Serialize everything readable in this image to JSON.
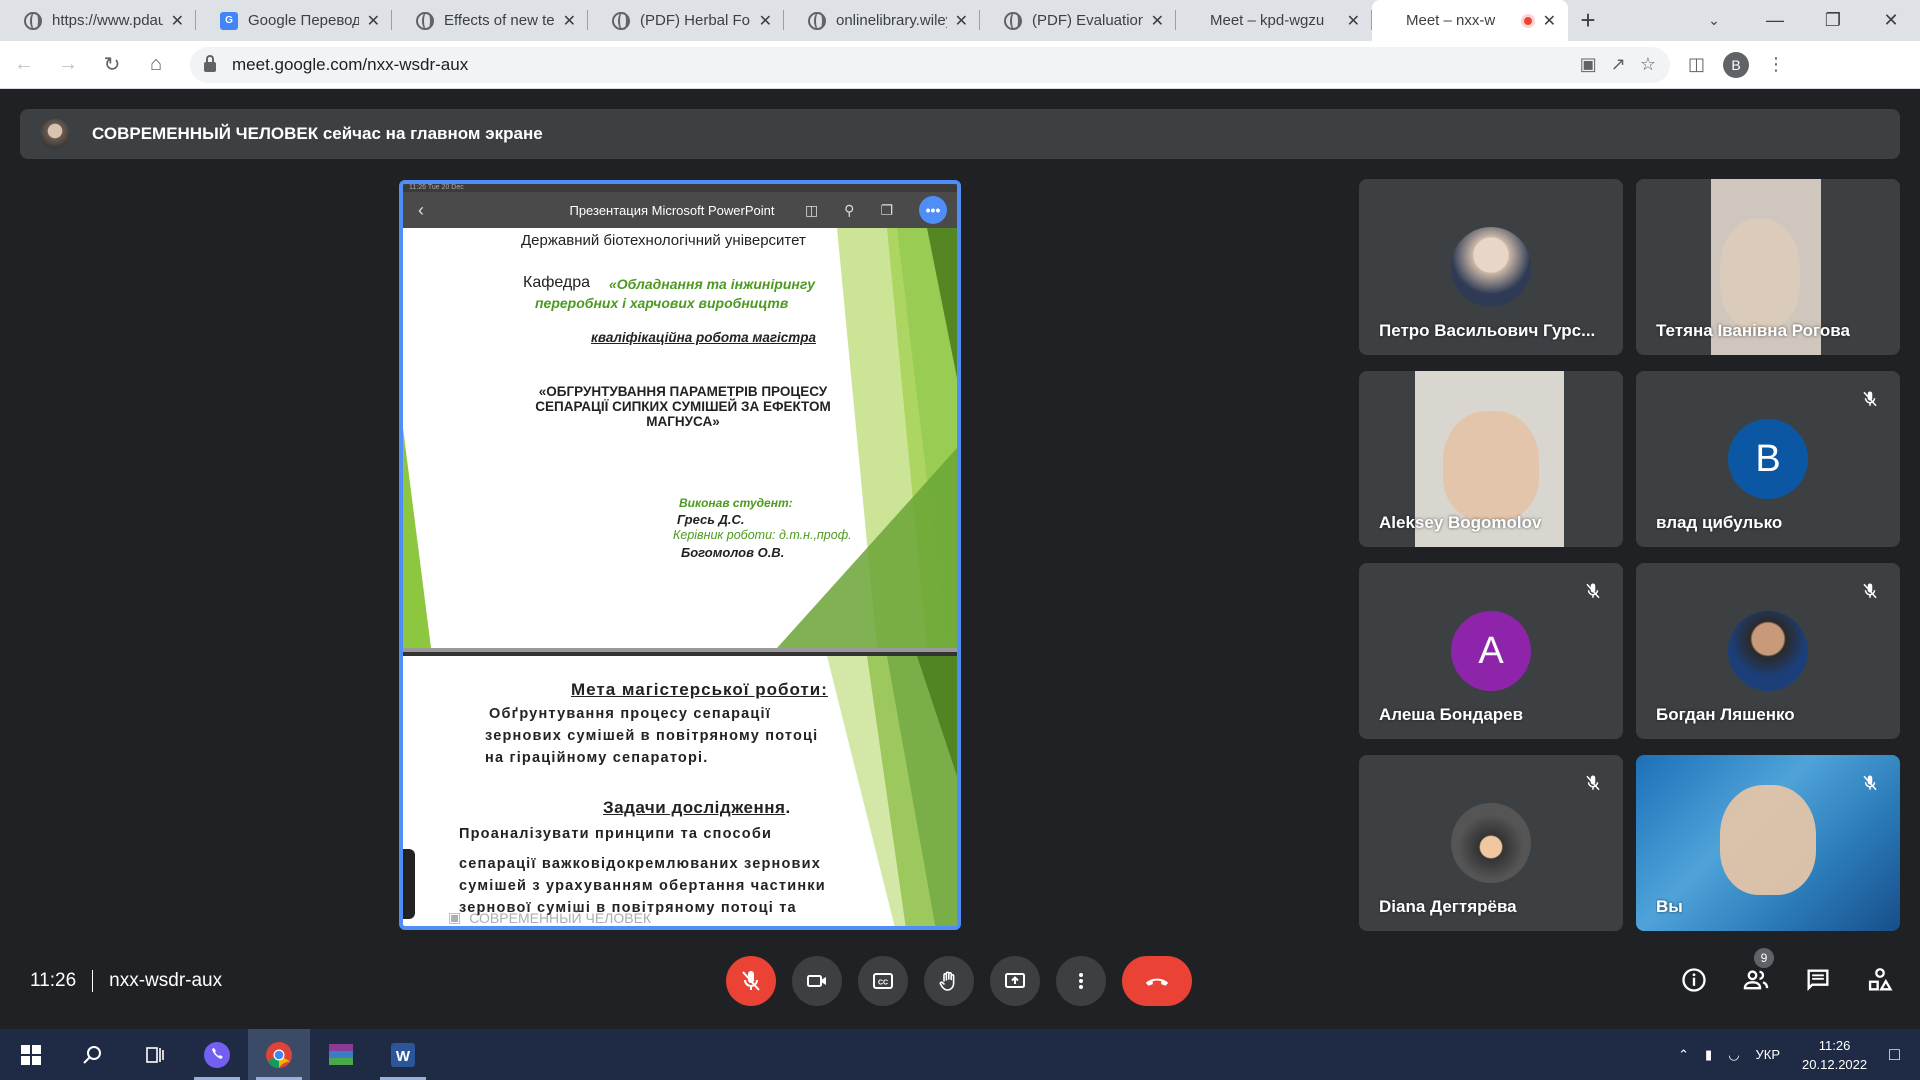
{
  "browser": {
    "tabs": [
      {
        "title": "https://www.pdau",
        "icon": "globe"
      },
      {
        "title": "Google Перевод",
        "icon": "translate"
      },
      {
        "title": "Effects of new tec",
        "icon": "globe"
      },
      {
        "title": "(PDF) Herbal Forti",
        "icon": "globe"
      },
      {
        "title": "onlinelibrary.wiley",
        "icon": "globe"
      },
      {
        "title": "(PDF) Evaluation c",
        "icon": "globe"
      },
      {
        "title": "Meet – kpd-wgzu",
        "icon": "meet"
      },
      {
        "title": "Meet – nxx-w",
        "icon": "meet",
        "active": true
      }
    ],
    "new_tab": "+",
    "url": "meet.google.com/nxx-wsdr-aux",
    "profile_letter": "B"
  },
  "meet": {
    "banner_text": "СОВРЕМЕННЫЙ ЧЕЛОВЕК сейчас на главном экране",
    "presentation": {
      "status_left": "11:26  Tue 20 Dec",
      "app_title": "Презентация Microsoft PowerPoint",
      "slide1": {
        "line1": "Державний біотехнологічний університет",
        "kafedra_label": "Кафедра",
        "kafedra_name_1": "«Обладнання та інжинірингу",
        "kafedra_name_2": "переробних і харчових виробництв",
        "work_type": "кваліфікаційна робота магістра",
        "title_1": "«ОБГРУНТУВАННЯ ПАРАМЕТРІВ ПРОЦЕСУ",
        "title_2": "СЕПАРАЦІЇ СИПКИХ СУМІШЕЙ ЗА ЕФЕКТОМ",
        "title_3": "МАГНУСА»",
        "student_label": "Виконав студент:",
        "student_name": "Гресь Д.С.",
        "supervisor_label": "Керівник роботи: д.т.н.,проф.",
        "supervisor_name": "Богомолов О.В."
      },
      "slide2": {
        "goal_heading": "Мета магістерської роботи:",
        "goal_1": "Обґрунтування процесу сепарації",
        "goal_2": "зернових сумішей в повітряному потоці",
        "goal_3": "на гіраційному сепараторі.",
        "tasks_heading": "Задачи дослідження",
        "tasks_dot": ".",
        "task_1": "Проаналізувати принципи та способи",
        "task_2": "сепарації важковідокремлюваних зернових",
        "task_3": "сумішей з урахуванням обертання частинки",
        "task_4": "зернової суміші в повітряному потоці та"
      },
      "watermark": "СОВРЕМЕННЫЙ ЧЕЛОВЕК"
    },
    "participants": [
      {
        "name": "Петро Васильович Гурс...",
        "kind": "photo",
        "muted": false
      },
      {
        "name": "Тетяна Іванівна Рогова",
        "kind": "video",
        "muted": false
      },
      {
        "name": "Aleksey Bogomolov",
        "kind": "video",
        "muted": false
      },
      {
        "name": "влад цибулько",
        "kind": "letter",
        "letter": "B",
        "color": "#0b57a4",
        "muted": true
      },
      {
        "name": "Алеша Бондарев",
        "kind": "letter",
        "letter": "A",
        "color": "#8e24aa",
        "muted": true
      },
      {
        "name": "Богдан Ляшенко",
        "kind": "photo",
        "muted": true
      },
      {
        "name": "Diana Дегтярёва",
        "kind": "photo",
        "muted": true
      },
      {
        "name": "Вы",
        "kind": "video",
        "muted": true
      }
    ],
    "time": "11:26",
    "meeting_code": "nxx-wsdr-aux",
    "participant_count": "9",
    "accent_red": "#ea4335",
    "present_border": "#4f8ef7"
  },
  "taskbar": {
    "lang": "УКР",
    "time": "11:26",
    "date": "20.12.2022"
  }
}
